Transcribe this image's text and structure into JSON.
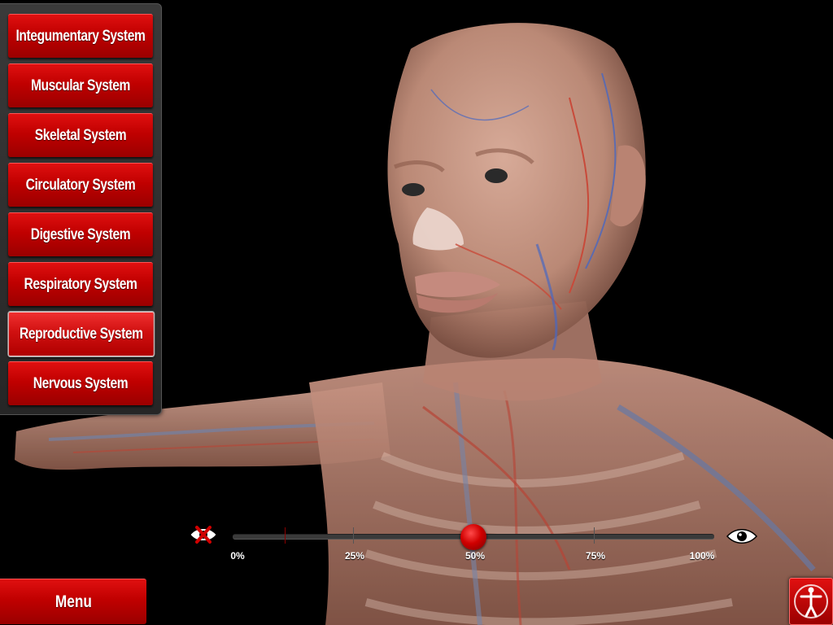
{
  "systems_menu": {
    "items": [
      {
        "label": "Integumentary System",
        "selected": false
      },
      {
        "label": "Muscular System",
        "selected": false
      },
      {
        "label": "Skeletal System",
        "selected": false
      },
      {
        "label": "Circulatory System",
        "selected": false
      },
      {
        "label": "Digestive System",
        "selected": false
      },
      {
        "label": "Respiratory System",
        "selected": false
      },
      {
        "label": "Reproductive System",
        "selected": true
      },
      {
        "label": "Nervous System",
        "selected": false
      }
    ]
  },
  "transparency_slider": {
    "value_percent": 50,
    "ticks": [
      "0%",
      "25%",
      "50%",
      "75%",
      "100%"
    ],
    "left_icon": "hide-eye-icon",
    "right_icon": "eye-icon"
  },
  "footer": {
    "menu_label": "Menu",
    "body_view_icon": "human-figure-icon"
  },
  "colors": {
    "button_red": "#c00000",
    "panel_gray": "#2e2e2e",
    "background": "#000000"
  }
}
